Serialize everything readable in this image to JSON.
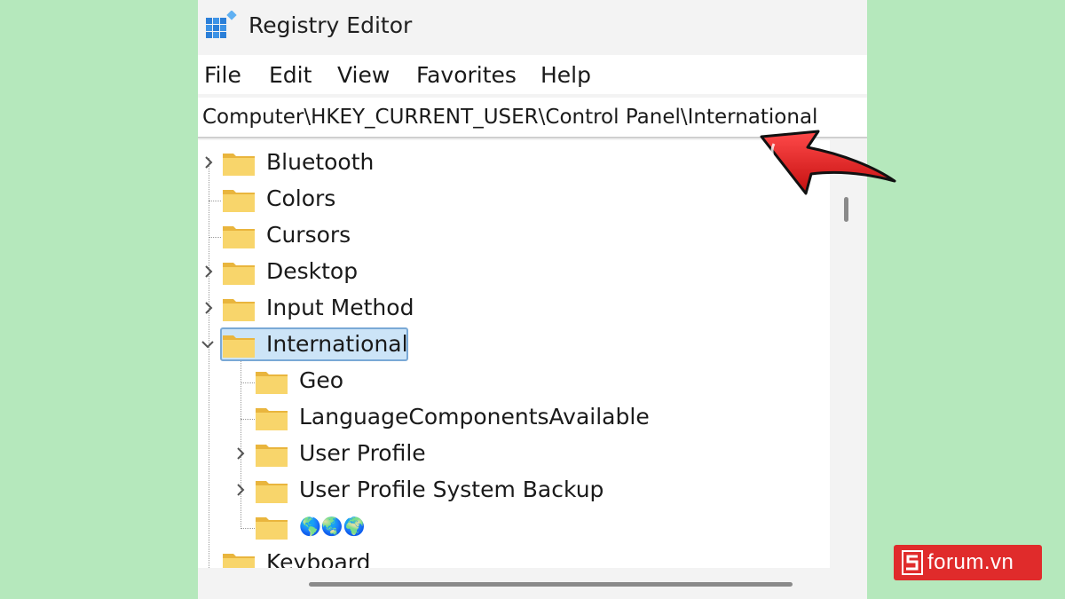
{
  "window": {
    "title": "Registry Editor"
  },
  "menu": {
    "items": [
      "File",
      "Edit",
      "View",
      "Favorites",
      "Help"
    ]
  },
  "address": {
    "path": "Computer\\HKEY_CURRENT_USER\\Control Panel\\International"
  },
  "tree": {
    "items": [
      {
        "label": "Bluetooth",
        "expander": "collapsed"
      },
      {
        "label": "Colors",
        "expander": "none"
      },
      {
        "label": "Cursors",
        "expander": "none"
      },
      {
        "label": "Desktop",
        "expander": "collapsed"
      },
      {
        "label": "Input Method",
        "expander": "collapsed"
      },
      {
        "label": "International",
        "expander": "expanded",
        "selected": true
      },
      {
        "label": "Geo",
        "expander": "none",
        "child": true
      },
      {
        "label": "LanguageComponentsAvailable",
        "expander": "none",
        "child": true
      },
      {
        "label": "User Profile",
        "expander": "collapsed",
        "child": true
      },
      {
        "label": "User Profile System Backup",
        "expander": "collapsed",
        "child": true
      },
      {
        "label": "🌎🌏🌍",
        "expander": "none",
        "child": true
      },
      {
        "label": "Keyboard",
        "expander": "none"
      }
    ]
  },
  "annotation": {
    "arrow_color": "#e01b1b",
    "points_to": "International"
  },
  "watermark": {
    "text": "forum.vn",
    "color": "#e02b2b"
  }
}
